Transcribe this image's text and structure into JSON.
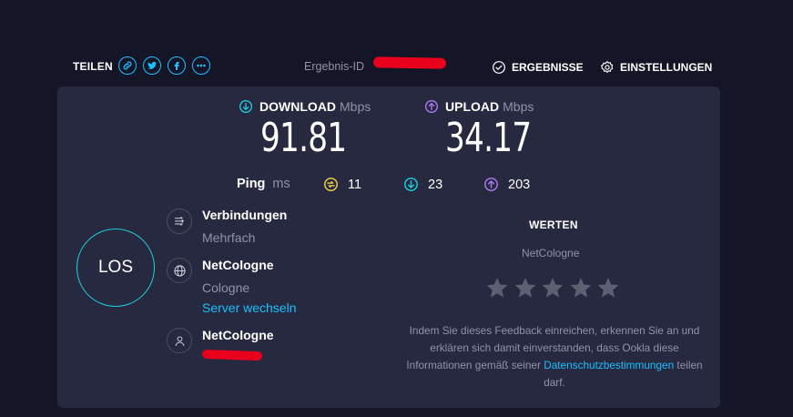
{
  "header": {
    "share_label": "TEILEN",
    "share_icons": [
      "link-icon",
      "twitter-icon",
      "facebook-icon",
      "more-icon"
    ],
    "result_id_label": "Ergebnis-ID",
    "results_label": "ERGEBNISSE",
    "settings_label": "EINSTELLUNGEN"
  },
  "download": {
    "label": "DOWNLOAD",
    "unit": "Mbps",
    "value": "91.81"
  },
  "upload": {
    "label": "UPLOAD",
    "unit": "Mbps",
    "value": "34.17"
  },
  "ping": {
    "label": "Ping",
    "unit": "ms",
    "idle": "11",
    "download": "23",
    "upload": "203"
  },
  "go_button": "LOS",
  "connections": {
    "title": "Verbindungen",
    "value": "Mehrfach"
  },
  "server": {
    "name": "NetCologne",
    "location": "Cologne",
    "change_link": "Server wechseln"
  },
  "provider": {
    "name": "NetCologne"
  },
  "rating": {
    "title": "WERTEN",
    "isp": "NetCologne",
    "stars": 5,
    "legal_text_1": "Indem Sie dieses Feedback einreichen, erkennen Sie an und erklären sich damit einverstanden, dass Ookla diese Informationen gemäß seiner ",
    "legal_link": "Datenschutzbestimmungen",
    "legal_text_2": " teilen darf."
  },
  "colors": {
    "background": "#141526",
    "panel": "#26293f",
    "accent_blue": "#1cbfff",
    "download_cyan": "#1fd0df",
    "upload_purple": "#b07cf5",
    "ping_yellow": "#f3d447"
  }
}
